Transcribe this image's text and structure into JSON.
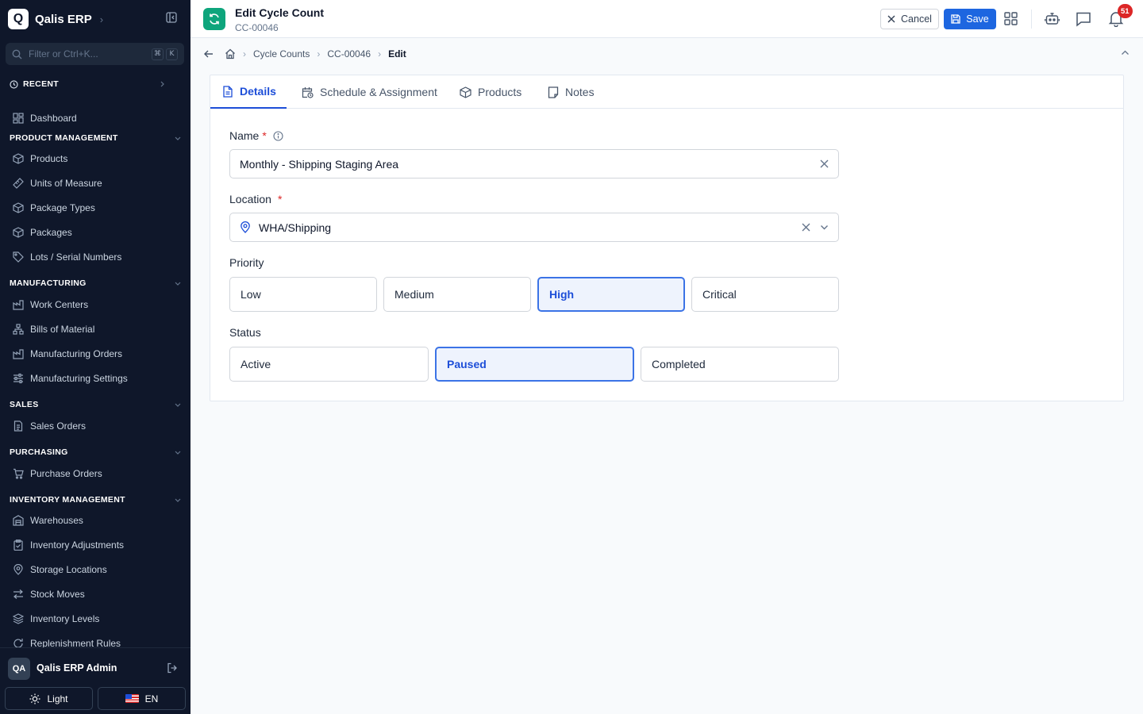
{
  "sidebar": {
    "brand": {
      "logo_letter": "Q",
      "name": "Qalis ERP",
      "chevron": "›"
    },
    "filter_placeholder": "Filter or Ctrl+K...",
    "kbd": [
      "⌘",
      "K"
    ],
    "recent_label": "RECENT",
    "dashboard": "Dashboard",
    "sections": {
      "product": {
        "title": "PRODUCT MANAGEMENT",
        "items": [
          "Products",
          "Units of Measure",
          "Package Types",
          "Packages",
          "Lots / Serial Numbers"
        ]
      },
      "manufacturing": {
        "title": "MANUFACTURING",
        "items": [
          "Work Centers",
          "Bills of Material",
          "Manufacturing Orders",
          "Manufacturing Settings"
        ]
      },
      "sales": {
        "title": "SALES",
        "items": [
          "Sales Orders"
        ]
      },
      "purchasing": {
        "title": "PURCHASING",
        "items": [
          "Purchase Orders"
        ]
      },
      "inventory": {
        "title": "INVENTORY MANAGEMENT",
        "items": [
          "Warehouses",
          "Inventory Adjustments",
          "Storage Locations",
          "Stock Moves",
          "Inventory Levels",
          "Replenishment Rules"
        ]
      }
    },
    "user": {
      "initials": "QA",
      "name": "Qalis ERP Admin"
    },
    "theme_label": "Light",
    "lang_label": "EN"
  },
  "header": {
    "title": "Edit Cycle Count",
    "subtitle": "CC-00046",
    "cancel_label": "Cancel",
    "save_label": "Save",
    "notification_count": "51",
    "accent_color": "#1d66e0",
    "icon_color": "#0ea57c"
  },
  "breadcrumb": {
    "items": [
      "Cycle Counts",
      "CC-00046"
    ],
    "current": "Edit"
  },
  "tabs": [
    "Details",
    "Schedule & Assignment",
    "Products",
    "Notes"
  ],
  "form": {
    "name": {
      "label": "Name",
      "required": "*",
      "value": "Monthly - Shipping Staging Area"
    },
    "location": {
      "label": "Location",
      "required": "*",
      "value": "WHA/Shipping"
    },
    "priority": {
      "label": "Priority",
      "options": [
        "Low",
        "Medium",
        "High",
        "Critical"
      ],
      "selected": "High"
    },
    "status": {
      "label": "Status",
      "options": [
        "Active",
        "Paused",
        "Completed"
      ],
      "selected": "Paused"
    }
  }
}
